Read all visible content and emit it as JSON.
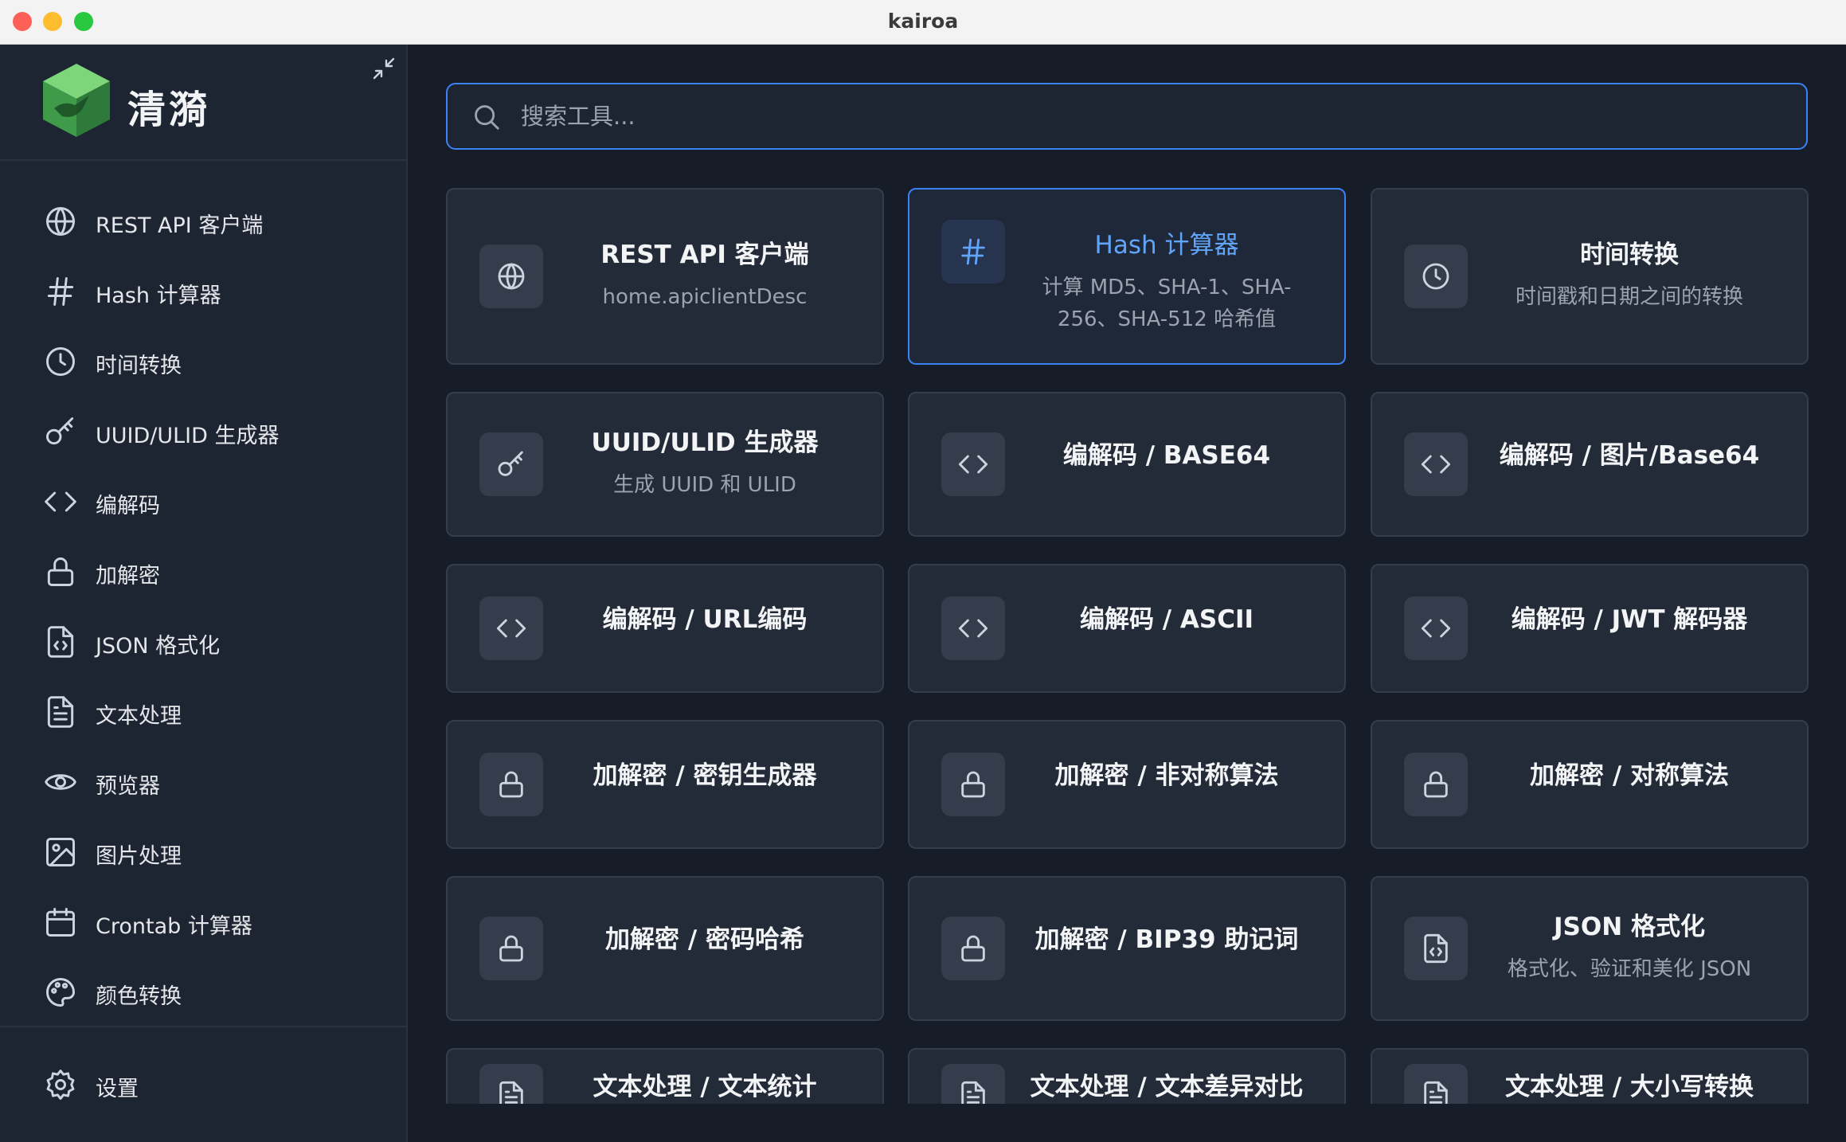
{
  "window": {
    "title": "kairoa"
  },
  "brand": {
    "name": "清漪"
  },
  "sidebar": {
    "items": [
      {
        "label": "REST API 客户端",
        "icon": "globe-icon"
      },
      {
        "label": "Hash 计算器",
        "icon": "hash-icon"
      },
      {
        "label": "时间转换",
        "icon": "clock-icon"
      },
      {
        "label": "UUID/ULID 生成器",
        "icon": "key-icon"
      },
      {
        "label": "编解码",
        "icon": "code-icon"
      },
      {
        "label": "加解密",
        "icon": "lock-icon"
      },
      {
        "label": "JSON 格式化",
        "icon": "file-code-icon"
      },
      {
        "label": "文本处理",
        "icon": "file-text-icon"
      },
      {
        "label": "预览器",
        "icon": "eye-icon"
      },
      {
        "label": "图片处理",
        "icon": "image-icon"
      },
      {
        "label": "Crontab 计算器",
        "icon": "calendar-icon"
      },
      {
        "label": "颜色转换",
        "icon": "palette-icon"
      }
    ],
    "settings_label": "设置"
  },
  "search": {
    "placeholder": "搜索工具..."
  },
  "cards": [
    {
      "title": "REST API 客户端",
      "desc": "home.apiclientDesc",
      "icon": "globe-icon"
    },
    {
      "title": "Hash 计算器",
      "desc": "计算 MD5、SHA-1、SHA-256、SHA-512 哈希值",
      "icon": "hash-icon",
      "active": true
    },
    {
      "title": "时间转换",
      "desc": "时间戳和日期之间的转换",
      "icon": "clock-icon"
    },
    {
      "title": "UUID/ULID 生成器",
      "desc": "生成 UUID 和 ULID",
      "icon": "key-icon"
    },
    {
      "title": "编解码 / BASE64",
      "icon": "code-icon"
    },
    {
      "title": "编解码 / 图片/Base64",
      "icon": "code-icon"
    },
    {
      "title": "编解码 / URL编码",
      "icon": "code-icon"
    },
    {
      "title": "编解码 / ASCII",
      "icon": "code-icon"
    },
    {
      "title": "编解码 / JWT 解码器",
      "icon": "code-icon"
    },
    {
      "title": "加解密 / 密钥生成器",
      "icon": "lock-icon"
    },
    {
      "title": "加解密 / 非对称算法",
      "icon": "lock-icon"
    },
    {
      "title": "加解密 / 对称算法",
      "icon": "lock-icon"
    },
    {
      "title": "加解密 / 密码哈希",
      "icon": "lock-icon"
    },
    {
      "title": "加解密 / BIP39 助记词",
      "icon": "lock-icon"
    },
    {
      "title": "JSON 格式化",
      "desc": "格式化、验证和美化 JSON",
      "icon": "file-code-icon"
    },
    {
      "title": "文本处理 / 文本统计",
      "icon": "file-text-icon"
    },
    {
      "title": "文本处理 / 文本差异对比",
      "icon": "file-text-icon"
    },
    {
      "title": "文本处理 / 大小写转换",
      "icon": "file-text-icon"
    }
  ],
  "colors": {
    "accent": "#3b82f6",
    "background": "#161c28",
    "sidebar": "#1d2432",
    "card": "#232a38"
  }
}
